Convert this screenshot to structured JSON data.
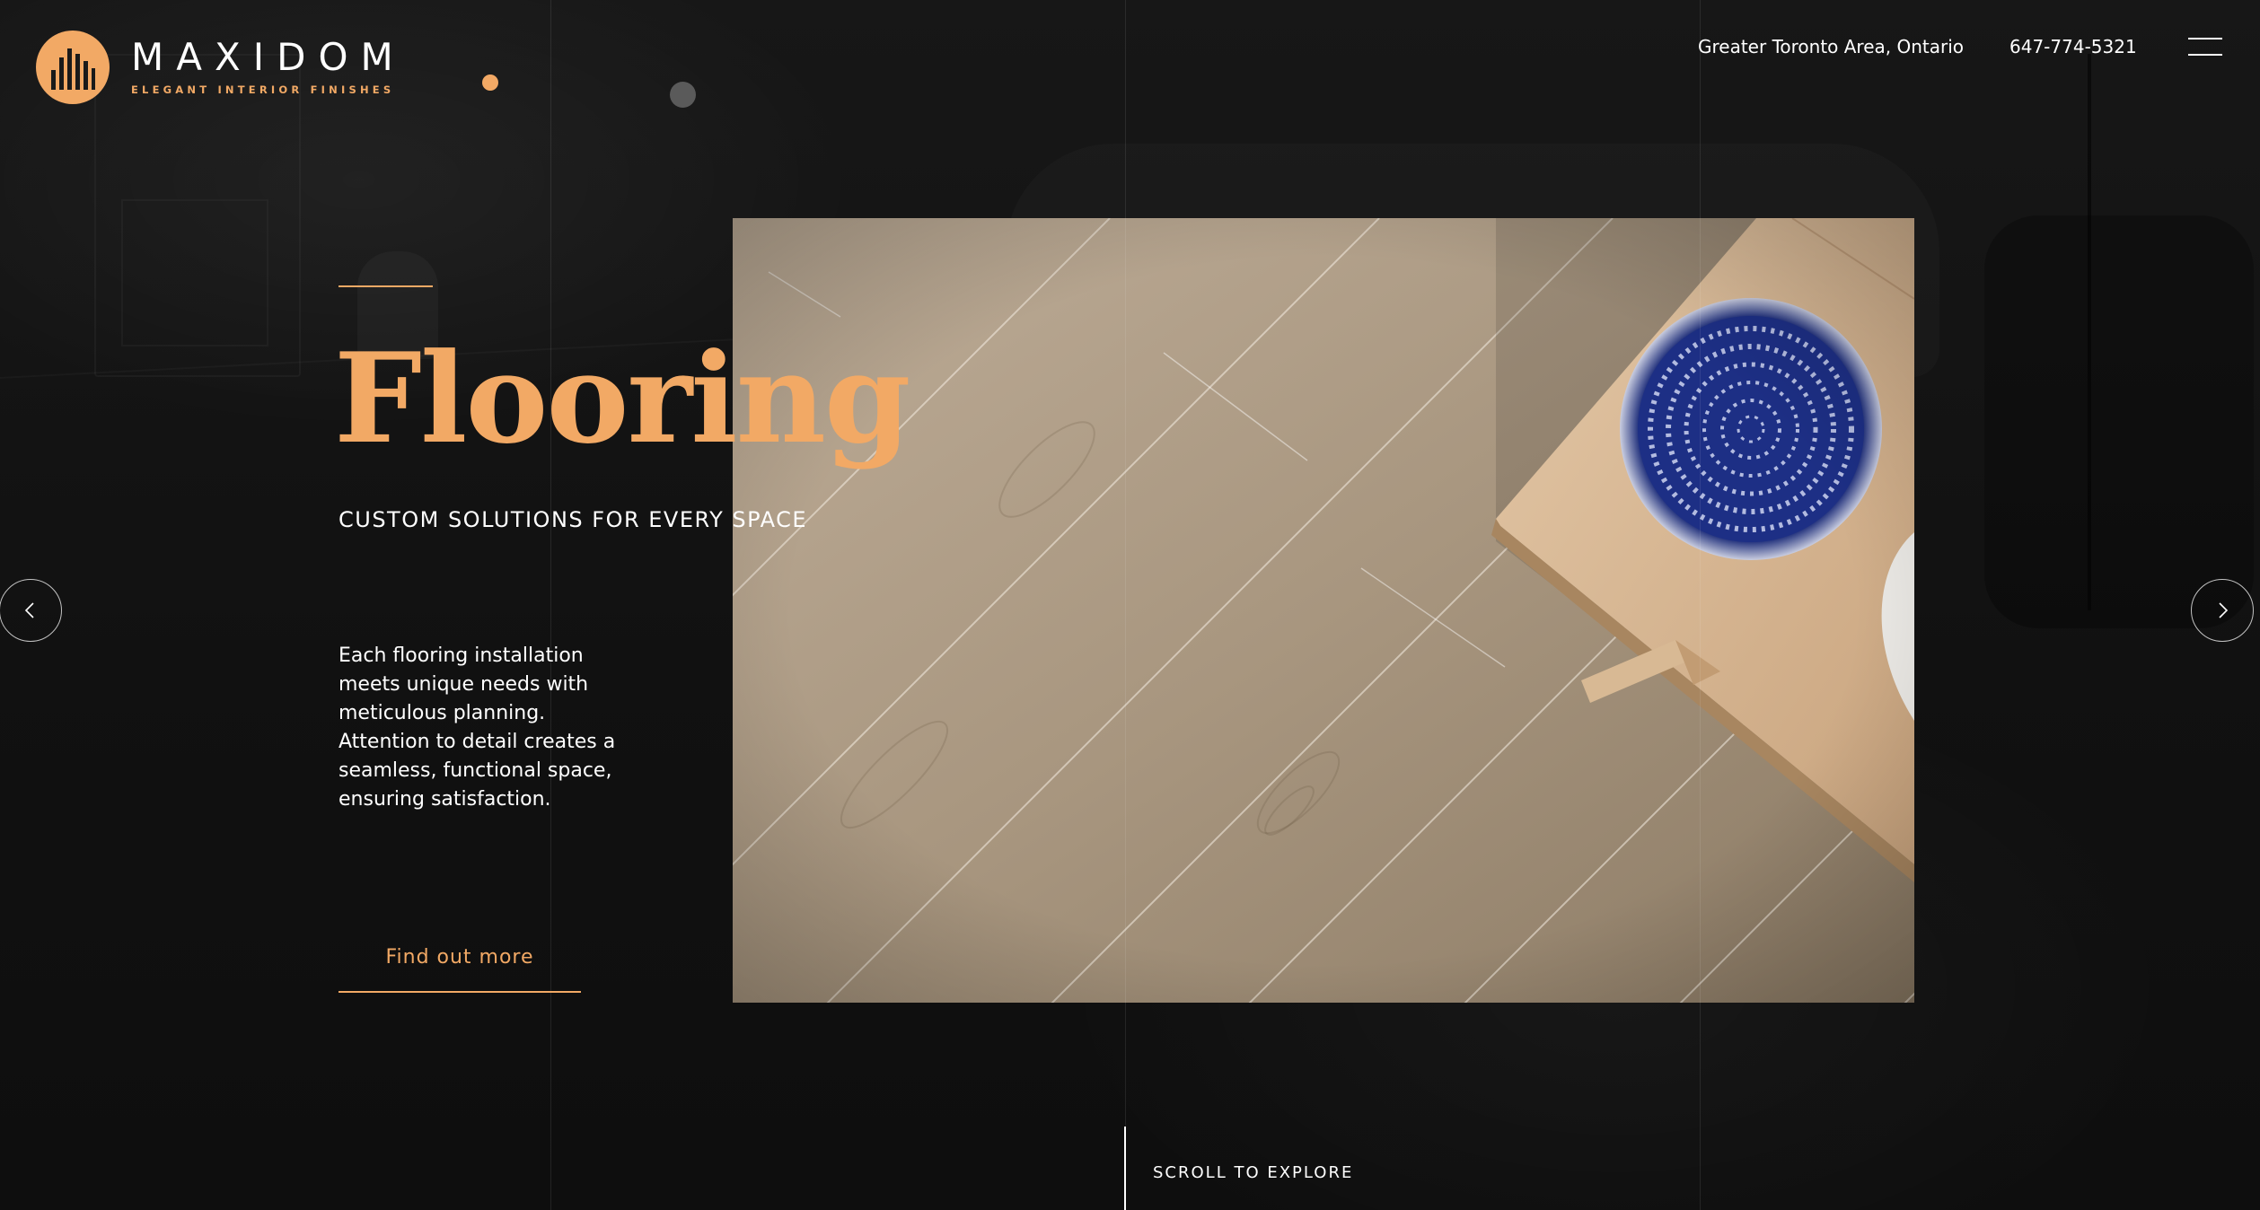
{
  "brand": {
    "name": "MAXIDOM",
    "tagline": "ELEGANT INTERIOR FINISHES",
    "accent_color": "#f2a965",
    "logo_icon": "building-bars-icon"
  },
  "header": {
    "location": "Greater Toronto Area, Ontario",
    "phone": "647-774-5321",
    "menu_icon": "hamburger-menu-icon"
  },
  "hero": {
    "title": "Flooring",
    "subtitle": "CUSTOM SOLUTIONS FOR EVERY SPACE",
    "description": "Each flooring installation meets unique needs with meticulous planning. Attention to detail creates a seamless, functional space, ensuring satisfaction.",
    "cta_label": "Find out more",
    "image_subject": "oak-floor-with-table-and-blue-bowl"
  },
  "navigation": {
    "prev_icon": "chevron-left-icon",
    "next_icon": "chevron-right-icon"
  },
  "scroll": {
    "label": "SCROLL TO EXPLORE"
  }
}
